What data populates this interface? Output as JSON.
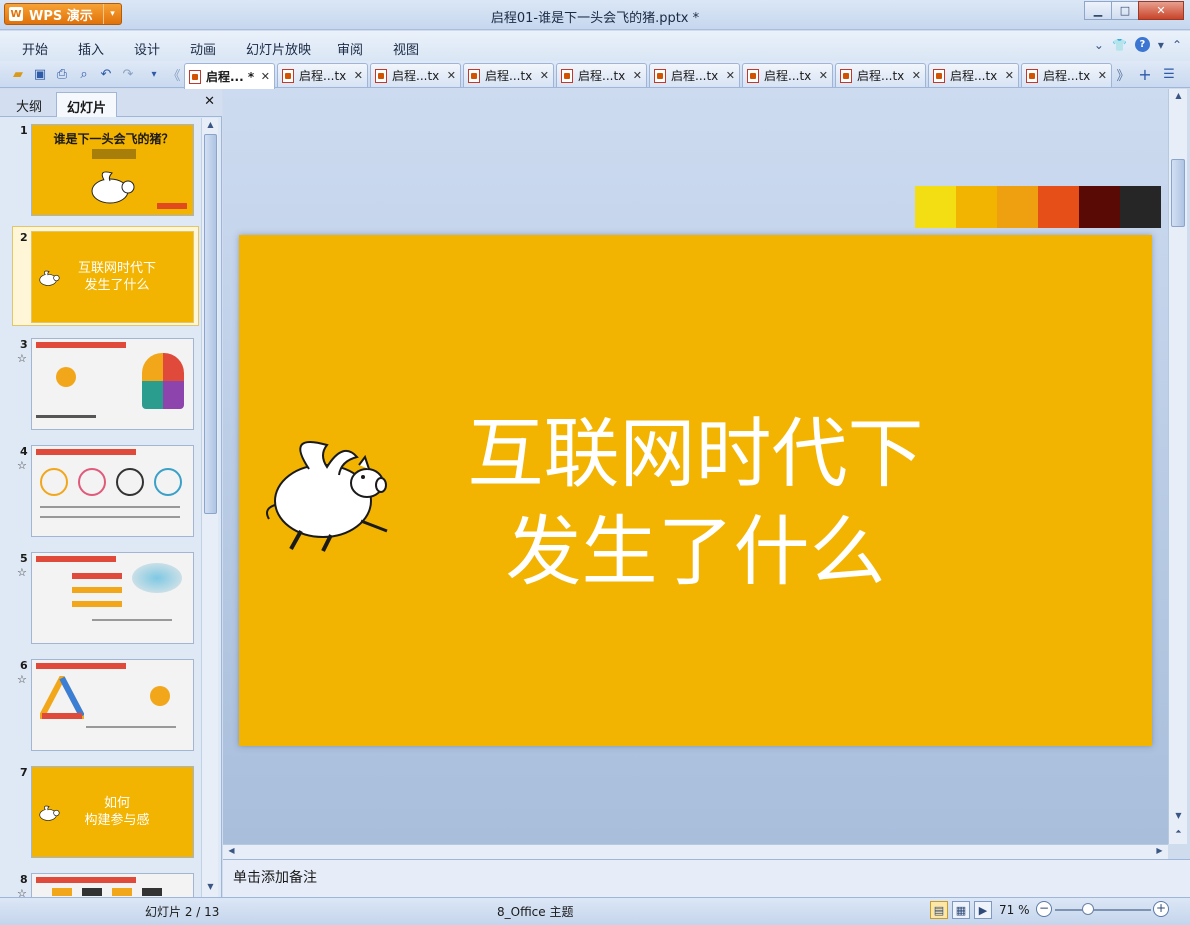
{
  "app": {
    "name": "WPS 演示",
    "window_title": "启程01-谁是下一头会飞的猪.pptx *"
  },
  "menu": {
    "items": [
      "开始",
      "插入",
      "设计",
      "动画",
      "幻灯片放映",
      "审阅",
      "视图"
    ]
  },
  "doc_tabs": [
    {
      "label": "启程... *",
      "active": true
    },
    {
      "label": "启程...tx",
      "active": false
    },
    {
      "label": "启程...tx",
      "active": false
    },
    {
      "label": "启程...tx",
      "active": false
    },
    {
      "label": "启程...tx",
      "active": false
    },
    {
      "label": "启程...tx",
      "active": false
    },
    {
      "label": "启程...tx",
      "active": false
    },
    {
      "label": "启程...tx",
      "active": false
    },
    {
      "label": "启程...tx",
      "active": false
    },
    {
      "label": "启程...tx",
      "active": false
    }
  ],
  "left_pane": {
    "tabs": [
      "大纲",
      "幻灯片"
    ],
    "active_tab": "幻灯片"
  },
  "thumbnails": [
    {
      "num": "1",
      "title": "谁是下一头会飞的猪？",
      "style": "orange-dark"
    },
    {
      "num": "2",
      "title": "互联网时代下\n发生了什么",
      "style": "orange"
    },
    {
      "num": "3",
      "title": "",
      "style": "white"
    },
    {
      "num": "4",
      "title": "",
      "style": "white"
    },
    {
      "num": "5",
      "title": "",
      "style": "white"
    },
    {
      "num": "6",
      "title": "",
      "style": "white"
    },
    {
      "num": "7",
      "title": "如何\n构建参与感",
      "style": "orange"
    },
    {
      "num": "8",
      "title": "",
      "style": "white"
    }
  ],
  "slide": {
    "title_line1": "互联网时代下",
    "title_line2": "发生了什么",
    "background": "#f2b400",
    "swatches": [
      "#f2de12",
      "#f2b400",
      "#eea010",
      "#e65018",
      "#5a0a04",
      "#262626"
    ]
  },
  "notes": {
    "placeholder": "单击添加备注"
  },
  "status": {
    "slide_info": "幻灯片 2 / 13",
    "theme": "8_Office 主题",
    "zoom": "71 %"
  }
}
